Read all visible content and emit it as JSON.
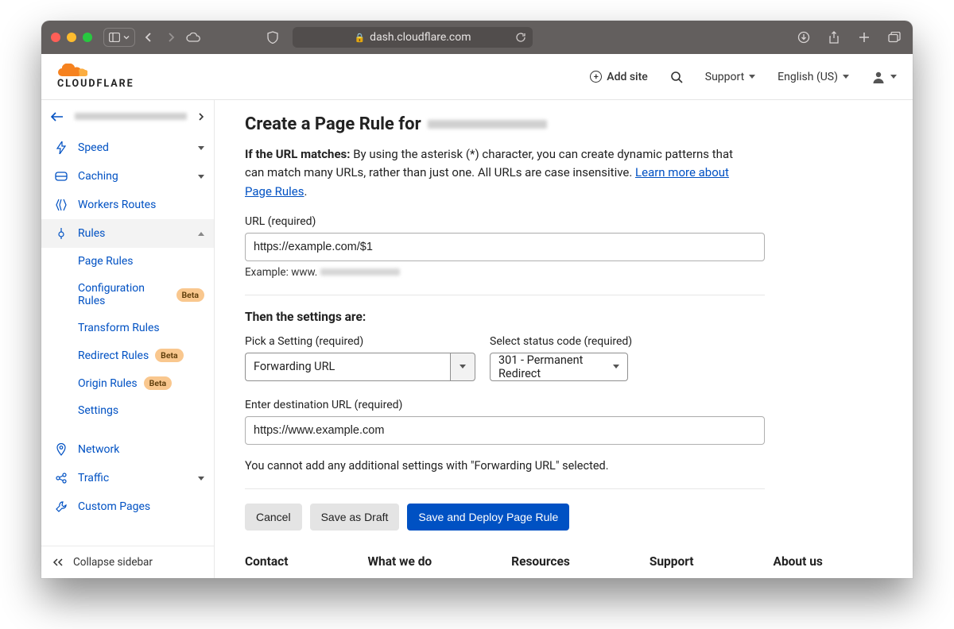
{
  "browser": {
    "url_host": "dash.cloudflare.com"
  },
  "topnav": {
    "add_site": "Add site",
    "support": "Support",
    "language": "English (US)"
  },
  "sidebar": {
    "items": [
      {
        "label": "Speed"
      },
      {
        "label": "Caching"
      },
      {
        "label": "Workers Routes"
      },
      {
        "label": "Rules"
      },
      {
        "label": "Network"
      },
      {
        "label": "Traffic"
      },
      {
        "label": "Custom Pages"
      }
    ],
    "rules_sub": [
      {
        "label": "Page Rules"
      },
      {
        "label": "Configuration Rules",
        "badge": "Beta"
      },
      {
        "label": "Transform Rules"
      },
      {
        "label": "Redirect Rules",
        "badge": "Beta"
      },
      {
        "label": "Origin Rules",
        "badge": "Beta"
      },
      {
        "label": "Settings"
      }
    ],
    "collapse": "Collapse sidebar"
  },
  "page": {
    "title_prefix": "Create a Page Rule for",
    "match_label": "If the URL matches:",
    "match_text": " By using the asterisk (*) character, you can create dynamic patterns that can match many URLs, rather than just one. All URLs are case insensitive. ",
    "learn_more": "Learn more about Page Rules",
    "url_label": "URL (required)",
    "url_value": "https://example.com/$1",
    "example_prefix": "Example: www.",
    "then_header": "Then the settings are:",
    "pick_label": "Pick a Setting (required)",
    "pick_value": "Forwarding URL",
    "status_label": "Select status code (required)",
    "status_value": "301 - Permanent Redirect",
    "dest_label": "Enter destination URL (required)",
    "dest_value": "https://www.example.com",
    "note": "You cannot add any additional settings with \"Forwarding URL\" selected.",
    "buttons": {
      "cancel": "Cancel",
      "draft": "Save as Draft",
      "deploy": "Save and Deploy Page Rule"
    }
  },
  "footer": {
    "c1": "Contact",
    "c2": "What we do",
    "c3": "Resources",
    "c4": "Support",
    "c5": "About us"
  }
}
